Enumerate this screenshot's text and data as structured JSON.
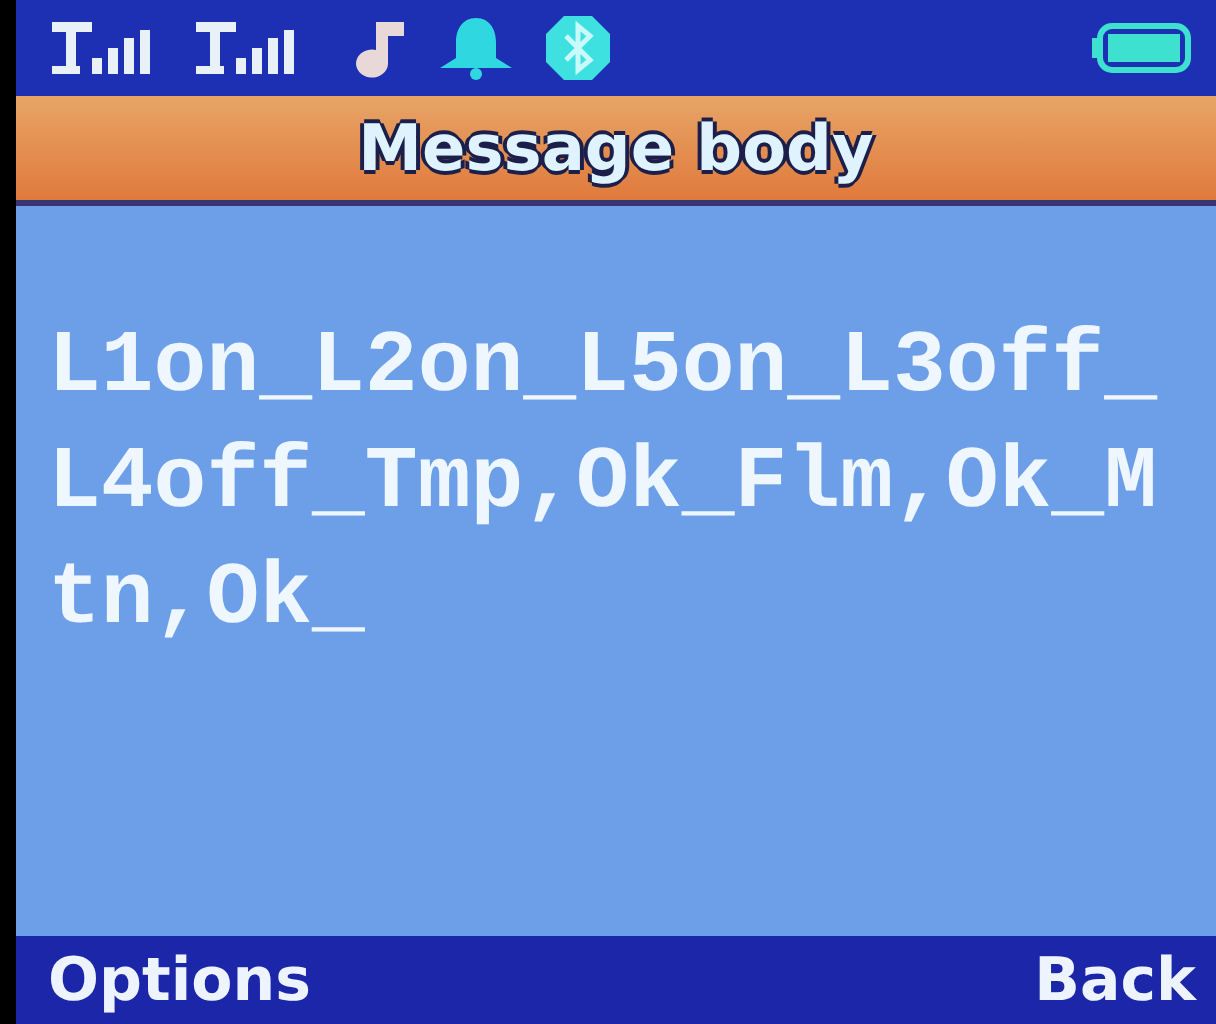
{
  "status_bar": {
    "sims": [
      {
        "kind": "signal"
      },
      {
        "kind": "signal"
      }
    ],
    "icons": [
      {
        "kind": "music"
      },
      {
        "kind": "bell"
      },
      {
        "kind": "bluetooth"
      }
    ],
    "battery": {
      "level": 1
    }
  },
  "title": "Message body",
  "message": "L1on_L2on_L5on_L3off_L4off_Tmp,Ok_Flm,Ok_Mtn,Ok_",
  "softkeys": {
    "left": "Options",
    "right": "Back"
  }
}
